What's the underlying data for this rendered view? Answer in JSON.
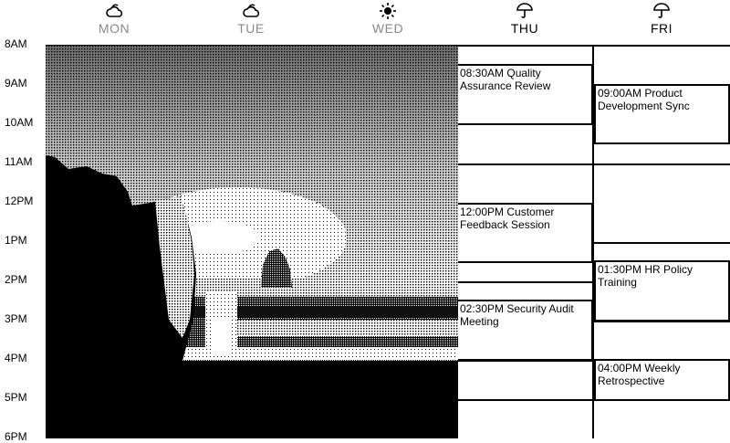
{
  "days": [
    {
      "label": "MON",
      "weather_icon": "partly-cloudy-icon"
    },
    {
      "label": "TUE",
      "weather_icon": "partly-cloudy-icon"
    },
    {
      "label": "WED",
      "weather_icon": "sun-icon"
    },
    {
      "label": "THU",
      "weather_icon": "umbrella-icon"
    },
    {
      "label": "FRI",
      "weather_icon": "umbrella-icon"
    }
  ],
  "hours": [
    "8AM",
    "9AM",
    "10AM",
    "11AM",
    "12PM",
    "1PM",
    "2PM",
    "3PM",
    "4PM",
    "5PM",
    "6PM"
  ],
  "events": {
    "thu": [
      {
        "time": "08:30AM",
        "title": "Quality Assurance Review"
      },
      {
        "time": "12:00PM",
        "title": "Customer Feedback Session"
      },
      {
        "time": "02:30PM",
        "title": "Security Audit Meeting"
      }
    ],
    "fri": [
      {
        "time": "09:00AM",
        "title": "Product Development Sync"
      },
      {
        "time": "01:30PM",
        "title": "HR Policy Training"
      },
      {
        "time": "04:00PM",
        "title": "Weekly Retrospective"
      }
    ]
  },
  "colors": {
    "past_day": "#8a8a8a",
    "ink": "#000000",
    "paper": "#ffffff"
  },
  "background_image": "dithered-coastal-sunset-photo"
}
